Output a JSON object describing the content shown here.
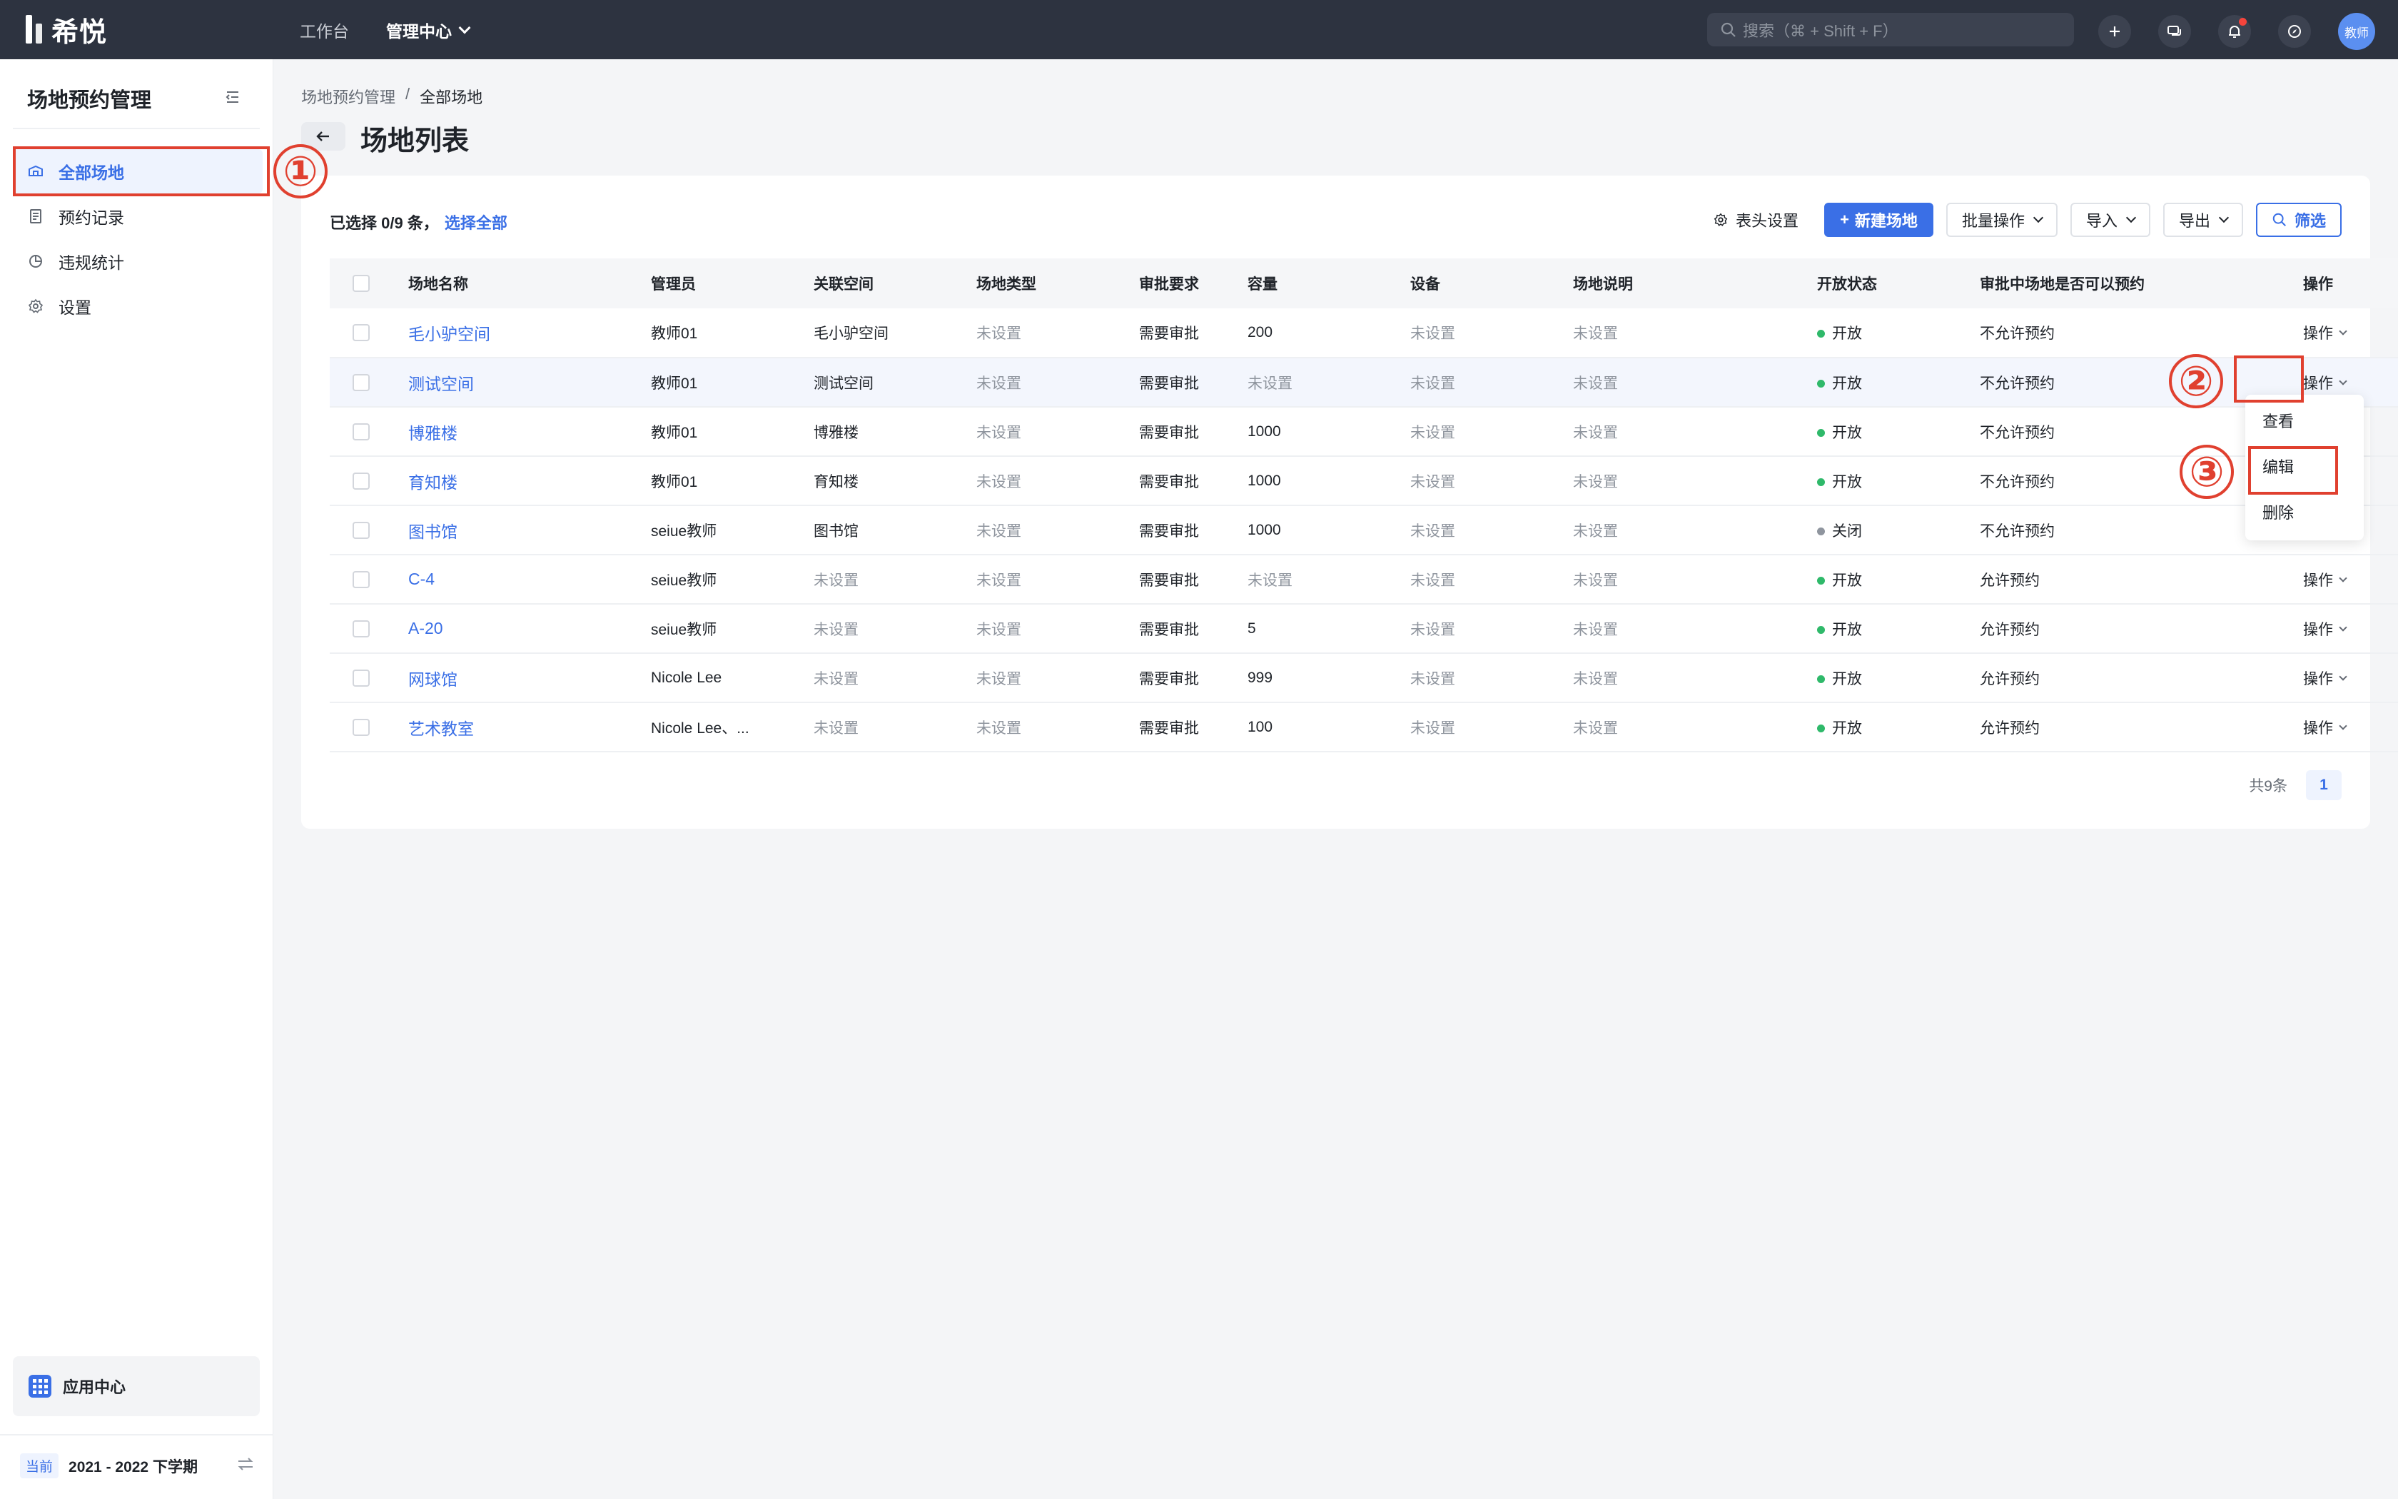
{
  "app": {
    "logo_text": "希悦"
  },
  "topnav": {
    "items": [
      "工作台"
    ],
    "active": "管理中心"
  },
  "search": {
    "placeholder": "搜索（⌘ + Shift + F）"
  },
  "user": {
    "avatar_text": "教师"
  },
  "sidebar": {
    "title": "场地预约管理",
    "items": [
      {
        "label": "全部场地",
        "icon": "venue-icon",
        "active": true
      },
      {
        "label": "预约记录",
        "icon": "document-icon"
      },
      {
        "label": "违规统计",
        "icon": "pie-icon"
      },
      {
        "label": "设置",
        "icon": "gear-icon"
      }
    ],
    "app_center": "应用中心",
    "term_badge": "当前",
    "term": "2021 - 2022 下学期"
  },
  "breadcrumb": {
    "parent": "场地预约管理",
    "sep": "/",
    "current": "全部场地"
  },
  "page_title": "场地列表",
  "selection": {
    "text": "已选择 0/9 条，",
    "select_all": "选择全部"
  },
  "toolbar": {
    "column_settings": "表头设置",
    "new_venue": "新建场地",
    "batch": "批量操作",
    "import": "导入",
    "export": "导出",
    "filter": "筛选"
  },
  "table": {
    "headers": [
      "场地名称",
      "管理员",
      "关联空间",
      "场地类型",
      "审批要求",
      "容量",
      "设备",
      "场地说明",
      "开放状态",
      "审批中场地是否可以预约",
      "操作"
    ],
    "rows": [
      {
        "name": "毛小驴空间",
        "admin": "教师01",
        "space": "毛小驴空间",
        "type": "未设置",
        "approval": "需要审批",
        "capacity": "200",
        "equipment": "未设置",
        "desc": "未设置",
        "status": "开放",
        "status_color": "#2fb96a",
        "booking": "不允许预约",
        "op": "操作"
      },
      {
        "name": "测试空间",
        "admin": "教师01",
        "space": "测试空间",
        "type": "未设置",
        "approval": "需要审批",
        "capacity": "未设置",
        "equipment": "未设置",
        "desc": "未设置",
        "status": "开放",
        "status_color": "#2fb96a",
        "booking": "不允许预约",
        "op": "操作"
      },
      {
        "name": "博雅楼",
        "admin": "教师01",
        "space": "博雅楼",
        "type": "未设置",
        "approval": "需要审批",
        "capacity": "1000",
        "equipment": "未设置",
        "desc": "未设置",
        "status": "开放",
        "status_color": "#2fb96a",
        "booking": "不允许预约",
        "op": ""
      },
      {
        "name": "育知楼",
        "admin": "教师01",
        "space": "育知楼",
        "type": "未设置",
        "approval": "需要审批",
        "capacity": "1000",
        "equipment": "未设置",
        "desc": "未设置",
        "status": "开放",
        "status_color": "#2fb96a",
        "booking": "不允许预约",
        "op": ""
      },
      {
        "name": "图书馆",
        "admin": "seiue教师",
        "space": "图书馆",
        "type": "未设置",
        "approval": "需要审批",
        "capacity": "1000",
        "equipment": "未设置",
        "desc": "未设置",
        "status": "关闭",
        "status_color": "#8f959e",
        "booking": "不允许预约",
        "op": ""
      },
      {
        "name": "C-4",
        "admin": "seiue教师",
        "space": "未设置",
        "type": "未设置",
        "approval": "需要审批",
        "capacity": "未设置",
        "equipment": "未设置",
        "desc": "未设置",
        "status": "开放",
        "status_color": "#2fb96a",
        "booking": "允许预约",
        "op": "操作"
      },
      {
        "name": "A-20",
        "admin": "seiue教师",
        "space": "未设置",
        "type": "未设置",
        "approval": "需要审批",
        "capacity": "5",
        "equipment": "未设置",
        "desc": "未设置",
        "status": "开放",
        "status_color": "#2fb96a",
        "booking": "允许预约",
        "op": "操作"
      },
      {
        "name": "网球馆",
        "admin": "Nicole Lee",
        "space": "未设置",
        "type": "未设置",
        "approval": "需要审批",
        "capacity": "999",
        "equipment": "未设置",
        "desc": "未设置",
        "status": "开放",
        "status_color": "#2fb96a",
        "booking": "允许预约",
        "op": "操作"
      },
      {
        "name": "艺术教室",
        "admin": "Nicole Lee、...",
        "space": "未设置",
        "type": "未设置",
        "approval": "需要审批",
        "capacity": "100",
        "equipment": "未设置",
        "desc": "未设置",
        "status": "开放",
        "status_color": "#2fb96a",
        "booking": "允许预约",
        "op": "操作"
      }
    ]
  },
  "pagination": {
    "total": "共9条",
    "page": "1"
  },
  "dropdown": {
    "items": [
      "查看",
      "编辑",
      "删除"
    ]
  },
  "annotations": [
    "①",
    "②",
    "③"
  ],
  "colors": {
    "accent": "#3a6fe6",
    "annotation": "#e0402f",
    "topbar": "#2d3340"
  }
}
